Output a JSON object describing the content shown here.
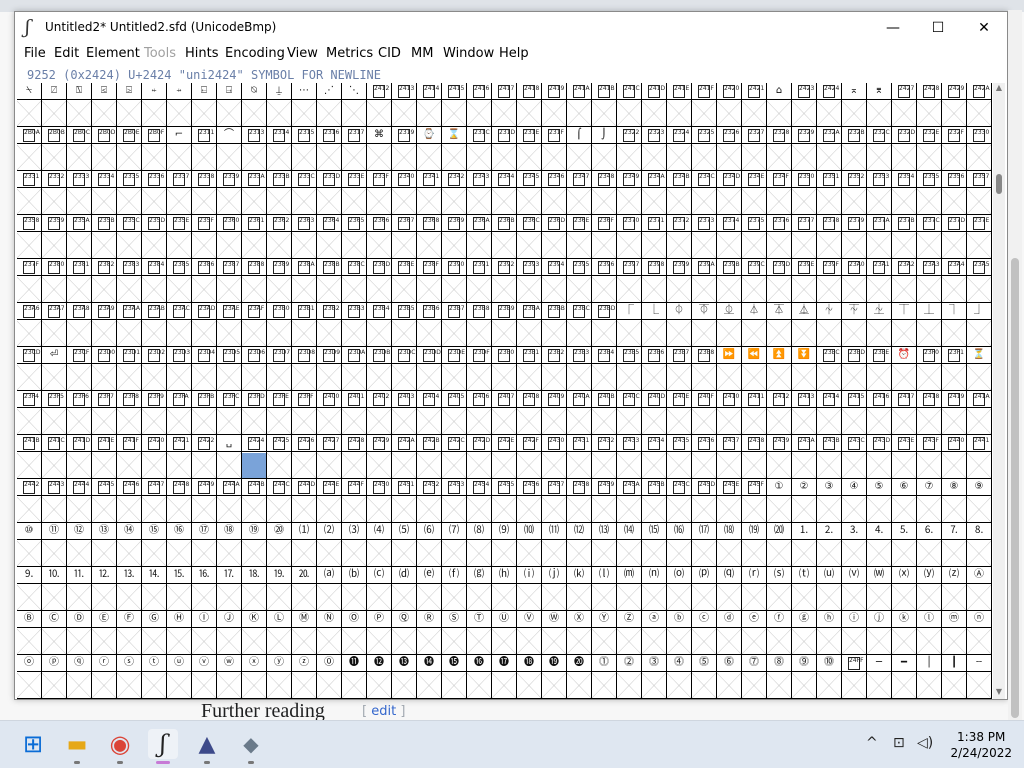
{
  "window": {
    "title": "Untitled2*  Untitled2.sfd (UnicodeBmp)",
    "app_icon_char": "ʃ",
    "controls": {
      "minimize": "—",
      "maximize": "☐",
      "close": "✕"
    }
  },
  "menu": [
    {
      "label": "File",
      "enabled": true
    },
    {
      "label": "Edit",
      "enabled": true
    },
    {
      "label": "Element",
      "enabled": true
    },
    {
      "label": "Tools",
      "enabled": false
    },
    {
      "label": "Hints",
      "enabled": true
    },
    {
      "label": "Encoding",
      "enabled": true
    },
    {
      "label": "View",
      "enabled": true
    },
    {
      "label": "Metrics",
      "enabled": true
    },
    {
      "label": "CID",
      "enabled": true
    },
    {
      "label": "MM",
      "enabled": true
    },
    {
      "label": "Window",
      "enabled": true
    },
    {
      "label": "Help",
      "enabled": true
    }
  ],
  "glyph_info": " 9252 (0x2424) U+2424 \"uni2424\" SYMBOL FOR NEWLINE",
  "grid": {
    "columns": 39,
    "rows": 14,
    "selected_cell": {
      "row": 8,
      "col": 9
    },
    "rows_data": [
      [
        "⍀",
        "⍁",
        "⍂",
        "⍃",
        "⍄",
        "⍅",
        "⍆",
        "⍇",
        "⍈",
        "⍉",
        "⍊",
        "⋯",
        "⋰",
        "⋱",
        "2412",
        "2413",
        "2414",
        "2415",
        "2416",
        "2417",
        "2418",
        "2419",
        "241A",
        "241B",
        "241C",
        "241D",
        "241E",
        "241F",
        "2420",
        "2421",
        "⌂",
        "2423",
        "2424",
        "⌅",
        "⌆",
        "2427",
        "2428",
        "2429",
        "242A"
      ],
      [
        "2B0A",
        "2B0B",
        "2B0C",
        "2B0D",
        "2B0E",
        "2B0F",
        "⌐",
        "2311",
        "⌒",
        "2313",
        "2314",
        "2315",
        "2316",
        "2317",
        "⌘",
        "2319",
        "⌚",
        "⌛",
        "231C",
        "231D",
        "231E",
        "231F",
        "⌠",
        "⌡",
        "2322",
        "2323",
        "2324",
        "2325",
        "2326",
        "2327",
        "2328",
        "2329",
        "232A",
        "232B",
        "232C",
        "232D",
        "232E",
        "232F",
        "2330"
      ],
      [
        "2331",
        "2332",
        "2333",
        "2334",
        "2335",
        "2336",
        "2337",
        "2338",
        "2339",
        "233A",
        "233B",
        "233C",
        "233D",
        "233E",
        "233F",
        "2340",
        "2341",
        "2342",
        "2343",
        "2344",
        "2345",
        "2346",
        "2347",
        "2348",
        "2349",
        "234A",
        "234B",
        "234C",
        "234D",
        "234E",
        "234F",
        "2350",
        "2351",
        "2352",
        "2353",
        "2354",
        "2355",
        "2356",
        "2357"
      ],
      [
        "2358",
        "2359",
        "235A",
        "235B",
        "235C",
        "235D",
        "235E",
        "235F",
        "2360",
        "2361",
        "2362",
        "2363",
        "2364",
        "2365",
        "2366",
        "2367",
        "2368",
        "2369",
        "236A",
        "236B",
        "236C",
        "236D",
        "236E",
        "236F",
        "2370",
        "2371",
        "2372",
        "2373",
        "2374",
        "2375",
        "2376",
        "2377",
        "2378",
        "2379",
        "237A",
        "237B",
        "237C",
        "237D",
        "237E"
      ],
      [
        "237F",
        "2380",
        "2381",
        "2382",
        "2383",
        "2384",
        "2385",
        "2386",
        "2387",
        "2388",
        "2389",
        "238A",
        "238B",
        "238C",
        "238D",
        "238E",
        "238F",
        "2390",
        "2391",
        "2392",
        "2393",
        "2394",
        "2395",
        "2396",
        "2397",
        "2398",
        "2399",
        "239A",
        "239B",
        "239C",
        "239D",
        "239E",
        "239F",
        "23A0",
        "23A1",
        "23A2",
        "23A3",
        "23A4",
        "23A5"
      ],
      [
        "23A6",
        "23A7",
        "23A8",
        "23A9",
        "23AA",
        "23AB",
        "23AC",
        "23AD",
        "23AE",
        "23AF",
        "23B0",
        "23B1",
        "23B2",
        "23B3",
        "23B4",
        "23B5",
        "23B6",
        "23B7",
        "23B8",
        "23B9",
        "23BA",
        "23BB",
        "23BC",
        "23BD",
        "⎾",
        "⎿",
        "⏀",
        "⏁",
        "⏂",
        "⏃",
        "⏄",
        "⏅",
        "⏆",
        "⏇",
        "⏈",
        "⏉",
        "⏊",
        "⏋",
        "⏌"
      ],
      [
        "23CD",
        "⏎",
        "23CF",
        "23D0",
        "23D1",
        "23D2",
        "23D3",
        "23D4",
        "23D5",
        "23D6",
        "23D7",
        "23D8",
        "23D9",
        "23DA",
        "23DB",
        "23DC",
        "23DD",
        "23DE",
        "23DF",
        "23E0",
        "23E1",
        "23E2",
        "23E3",
        "23E4",
        "23E5",
        "23E6",
        "23E7",
        "23E8",
        "⏩",
        "⏪",
        "⏫",
        "⏬",
        "23EC",
        "23ED",
        "23EE",
        "⏰",
        "23F0",
        "23F1",
        "⏳"
      ],
      [
        "23F4",
        "23F5",
        "23F6",
        "23F7",
        "23F8",
        "23F9",
        "23FA",
        "23FB",
        "23FC",
        "23FD",
        "23FE",
        "23FF",
        "2400",
        "2401",
        "2402",
        "2403",
        "2404",
        "2405",
        "2406",
        "2407",
        "2408",
        "2409",
        "240A",
        "240B",
        "240C",
        "240D",
        "240E",
        "240F",
        "2410",
        "2411",
        "2412",
        "2413",
        "2414",
        "2415",
        "2416",
        "2417",
        "2418",
        "2419",
        "241A"
      ],
      [
        "241B",
        "241C",
        "241D",
        "241E",
        "241F",
        "2420",
        "2421",
        "2422",
        "␣",
        "2424",
        "2425",
        "2426",
        "2427",
        "2428",
        "2429",
        "242A",
        "242B",
        "242C",
        "242D",
        "242E",
        "242F",
        "2430",
        "2431",
        "2432",
        "2433",
        "2434",
        "2435",
        "2436",
        "2437",
        "2438",
        "2439",
        "243A",
        "243B",
        "243C",
        "243D",
        "243E",
        "243F",
        "2440",
        "2441"
      ],
      [
        "2442",
        "2443",
        "2444",
        "2445",
        "2446",
        "2447",
        "2448",
        "2449",
        "244A",
        "244B",
        "244C",
        "244D",
        "244E",
        "244F",
        "2450",
        "2451",
        "2452",
        "2453",
        "2454",
        "2455",
        "2456",
        "2457",
        "2458",
        "2459",
        "245A",
        "245B",
        "245C",
        "245D",
        "245E",
        "245F",
        "①",
        "②",
        "③",
        "④",
        "⑤",
        "⑥",
        "⑦",
        "⑧",
        "⑨"
      ],
      [
        "⑩",
        "⑪",
        "⑫",
        "⑬",
        "⑭",
        "⑮",
        "⑯",
        "⑰",
        "⑱",
        "⑲",
        "⑳",
        "⑴",
        "⑵",
        "⑶",
        "⑷",
        "⑸",
        "⑹",
        "⑺",
        "⑻",
        "⑼",
        "⑽",
        "⑾",
        "⑿",
        "⒀",
        "⒁",
        "⒂",
        "⒃",
        "⒄",
        "⒅",
        "⒆",
        "⒇",
        "⒈",
        "⒉",
        "⒊",
        "⒋",
        "⒌",
        "⒍",
        "⒎",
        "⒏"
      ],
      [
        "⒐",
        "⒑",
        "⒒",
        "⒓",
        "⒔",
        "⒕",
        "⒖",
        "⒗",
        "⒘",
        "⒙",
        "⒚",
        "⒛",
        "⒜",
        "⒝",
        "⒞",
        "⒟",
        "⒠",
        "⒡",
        "⒢",
        "⒣",
        "⒤",
        "⒥",
        "⒦",
        "⒧",
        "⒨",
        "⒩",
        "⒪",
        "⒫",
        "⒬",
        "⒭",
        "⒮",
        "⒯",
        "⒰",
        "⒱",
        "⒲",
        "⒳",
        "⒴",
        "⒵",
        "Ⓐ"
      ],
      [
        "Ⓑ",
        "Ⓒ",
        "Ⓓ",
        "Ⓔ",
        "Ⓕ",
        "Ⓖ",
        "Ⓗ",
        "Ⓘ",
        "Ⓙ",
        "Ⓚ",
        "Ⓛ",
        "Ⓜ",
        "Ⓝ",
        "Ⓞ",
        "Ⓟ",
        "Ⓠ",
        "Ⓡ",
        "Ⓢ",
        "Ⓣ",
        "Ⓤ",
        "Ⓥ",
        "Ⓦ",
        "Ⓧ",
        "Ⓨ",
        "Ⓩ",
        "ⓐ",
        "ⓑ",
        "ⓒ",
        "ⓓ",
        "ⓔ",
        "ⓕ",
        "ⓖ",
        "ⓗ",
        "ⓘ",
        "ⓙ",
        "ⓚ",
        "ⓛ",
        "ⓜ",
        "ⓝ"
      ],
      [
        "ⓞ",
        "ⓟ",
        "ⓠ",
        "ⓡ",
        "ⓢ",
        "ⓣ",
        "ⓤ",
        "ⓥ",
        "ⓦ",
        "ⓧ",
        "ⓨ",
        "ⓩ",
        "⓪",
        "⓫",
        "⓬",
        "⓭",
        "⓮",
        "⓯",
        "⓰",
        "⓱",
        "⓲",
        "⓳",
        "⓴",
        "⓵",
        "⓶",
        "⓷",
        "⓸",
        "⓹",
        "⓺",
        "⓻",
        "⓼",
        "⓽",
        "⓾",
        "24FF",
        "─",
        "━",
        "│",
        "┃",
        "┄"
      ]
    ]
  },
  "background_page": {
    "heading": "Further reading",
    "edit_bracket_open": "[",
    "edit_link": "edit",
    "edit_bracket_close": "]"
  },
  "taskbar": {
    "apps": [
      {
        "name": "start-icon",
        "glyph": "⊞",
        "color": "#0a6cd6"
      },
      {
        "name": "file-explorer-icon",
        "glyph": "▬",
        "color": "#e6a817"
      },
      {
        "name": "chrome-icon",
        "glyph": "◉",
        "color": "#db4437"
      },
      {
        "name": "fontforge-icon",
        "glyph": "ʃ",
        "color": "#222222"
      },
      {
        "name": "inkscape-icon",
        "glyph": "▲",
        "color": "#3d4a8a"
      },
      {
        "name": "virtualbox-icon",
        "glyph": "◆",
        "color": "#6a7a8a"
      }
    ],
    "tray": {
      "chevron": "^",
      "network": "⊡",
      "volume": "◁)"
    },
    "clock": {
      "time": "1:38 PM",
      "date": "2/24/2022"
    }
  }
}
